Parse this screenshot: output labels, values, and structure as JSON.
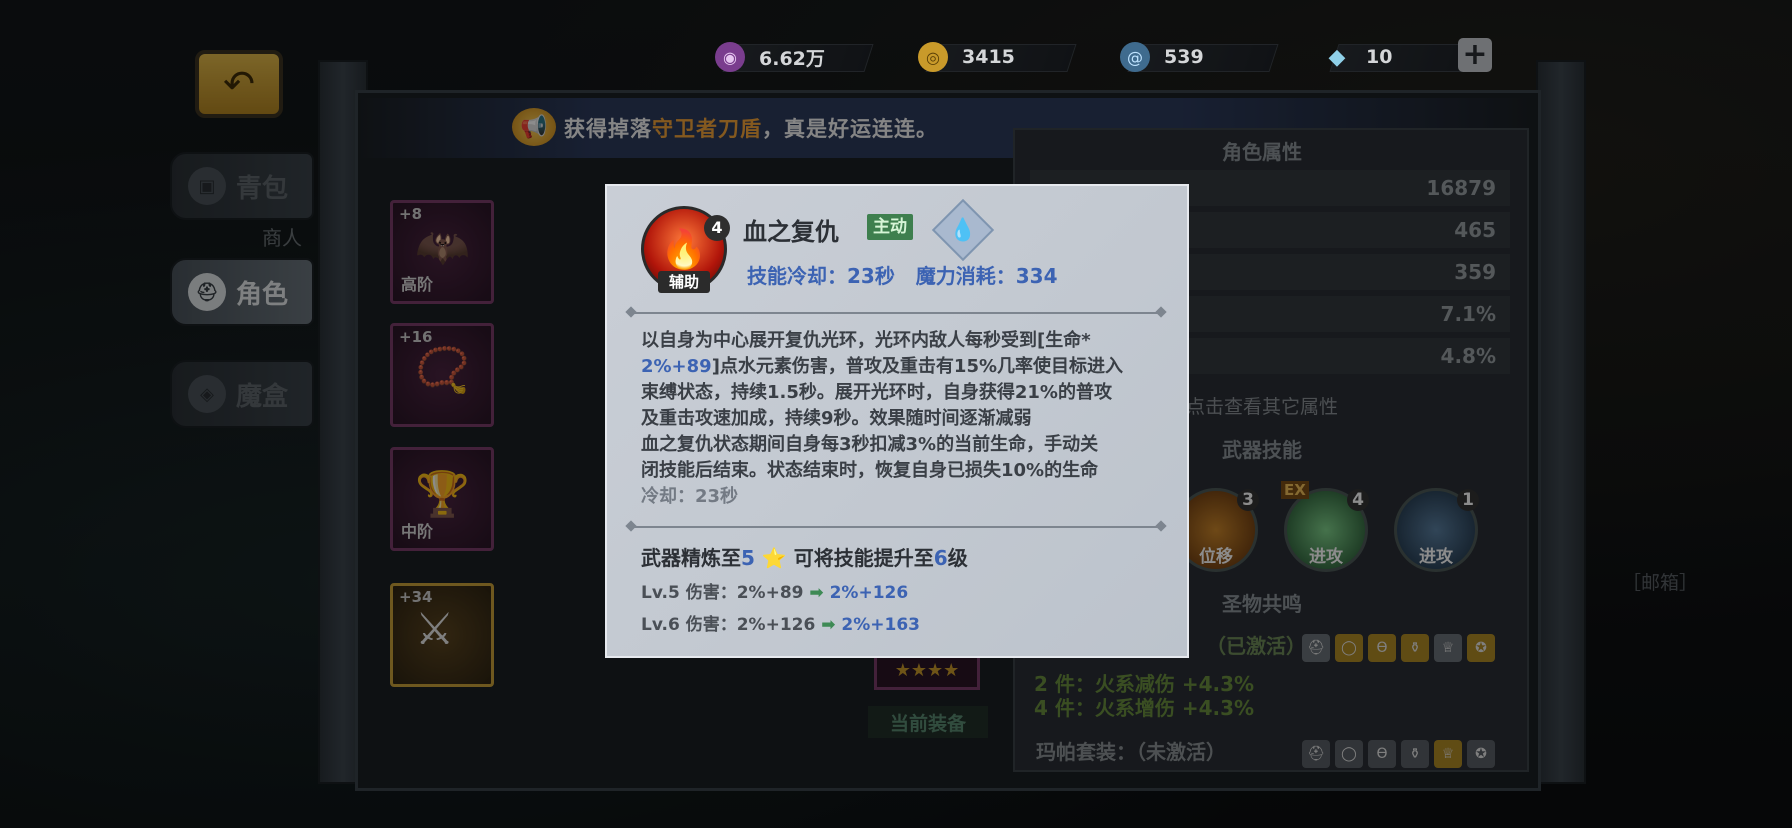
{
  "currencies": [
    {
      "name": "purple-gem-icon",
      "value": "6.62万",
      "color": "#7a3d8e"
    },
    {
      "name": "gold-coin-icon",
      "value": "3415",
      "color": "#c99a2a"
    },
    {
      "name": "spiral-orb-icon",
      "value": "539",
      "color": "#3f6b8e"
    },
    {
      "name": "diamond-icon",
      "value": "10",
      "color": "#8fd0e8"
    }
  ],
  "plus_label": "+",
  "banner": {
    "prefix": "获得掉落",
    "item": "守卫者刀盾",
    "suffix": "，真是好运连连。"
  },
  "menu": [
    {
      "label": "青包",
      "icon": "bag-icon"
    },
    {
      "label": "角色",
      "icon": "helmet-icon"
    },
    {
      "label": "魔盒",
      "icon": "box-icon"
    }
  ],
  "merchant_label": "商人",
  "slots": [
    {
      "level": "+8",
      "tier": "高阶"
    },
    {
      "level": "+16",
      "tier": ""
    },
    {
      "level": "",
      "tier": "中阶"
    },
    {
      "level": "+34",
      "tier": ""
    }
  ],
  "right_panel": {
    "header": "角色属性",
    "stats": [
      "16879",
      "465",
      "359",
      "7.1%",
      "4.8%"
    ],
    "check_other": "点击查看其它属性",
    "weapon_skills_title": "武器技能",
    "skills": [
      {
        "label": "位移",
        "num": "3"
      },
      {
        "label": "进攻",
        "num": "4",
        "ex": "EX"
      },
      {
        "label": "进攻",
        "num": "1"
      }
    ],
    "relic_title": "圣物共鸣",
    "set_activated": "（已激活）",
    "set_bonus_2": "2 件：火系减伤 +4.3%",
    "set_bonus_4": "4 件：火系增伤 +4.3%",
    "set_mapa": "玛帕套装：（未激活）"
  },
  "current_equip": "当前装备",
  "stars": "★★★★",
  "mail": "［邮箱］",
  "tooltip": {
    "level": "4",
    "role": "辅助",
    "name": "血之复仇",
    "type": "主动",
    "element_icon": "water-drop-icon",
    "cooldown_label": "技能冷却：23秒",
    "mana_label": "魔力消耗：334",
    "desc_1": "以自身为中心展开复仇光环，光环内敌人每秒受到[生命*",
    "desc_2_blue": "2%+89",
    "desc_2_rest": "]点水元素伤害，普攻及重击有15%几率使目标进入",
    "desc_3": "束缚状态，持续1.5秒。展开光环时，自身获得21%的普攻",
    "desc_4": "及重击攻速加成，持续9秒。效果随时间逐渐减弱",
    "desc_5": "血之复仇状态期间自身每3秒扣减3%的当前生命，手动关",
    "desc_6": "闭技能后结束。状态结束时，恢复自身已损失10%的生命",
    "desc_7": "冷却：23秒",
    "refine_prefix": "武器精炼至",
    "refine_level": "5",
    "refine_mid": "可将技能提升至",
    "refine_target": "6",
    "refine_suffix": "级",
    "lv5_label": "Lv.5 伤害：2%+89",
    "lv5_new": "2%+126",
    "lv6_label": "Lv.6 伤害：2%+126",
    "lv6_new": "2%+163"
  }
}
